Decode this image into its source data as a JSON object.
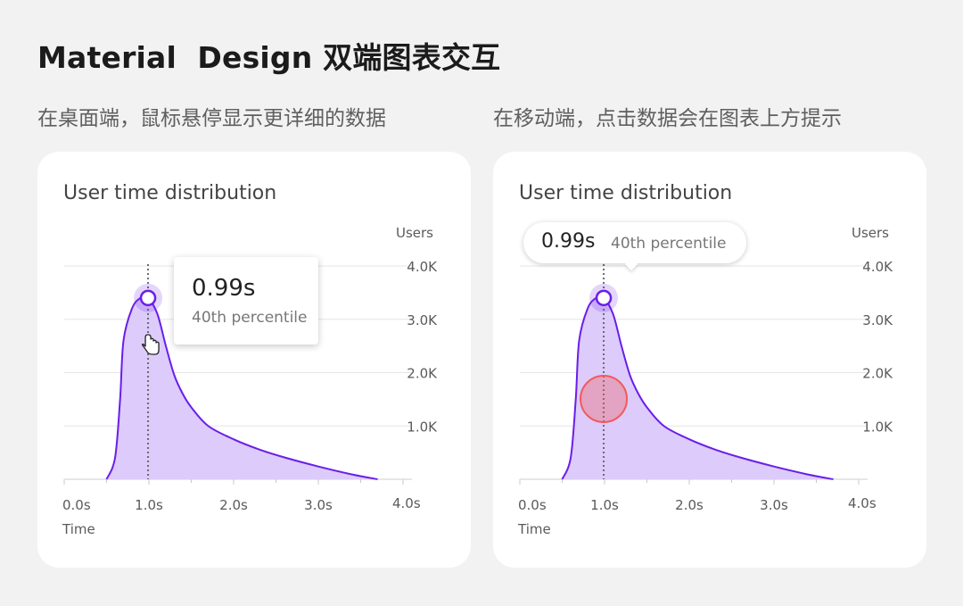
{
  "header": {
    "title": "Material  Design 双端图表交互",
    "caption_left": "在桌面端，鼠标悬停显示更详细的数据",
    "caption_right": "在移动端，点击数据会在图表上方提示"
  },
  "colors": {
    "line": "#6a1ee8",
    "fill": "#dccbfb",
    "touch": "#f25a5a"
  },
  "chart_data": [
    {
      "type": "area",
      "title": "User time distribution",
      "ylabel": "Users",
      "xlabel": "Time",
      "xlim": [
        0,
        4
      ],
      "ylim": [
        0,
        4000
      ],
      "x_ticks": [
        "0.0s",
        "1.0s",
        "2.0s",
        "3.0s",
        "4.0s"
      ],
      "y_ticks": [
        "1.0K",
        "2.0K",
        "3.0K",
        "4.0K"
      ],
      "grid": true,
      "series": [
        {
          "x": [
            0.5,
            0.6,
            0.66,
            0.7,
            0.8,
            0.9,
            0.99,
            1.1,
            1.2,
            1.3,
            1.4,
            1.5,
            1.7,
            2.0,
            2.3,
            2.6,
            3.0,
            3.4,
            3.7
          ],
          "values": [
            0,
            400,
            1500,
            2600,
            3200,
            3400,
            3400,
            3100,
            2500,
            1950,
            1600,
            1350,
            1000,
            750,
            560,
            410,
            240,
            90,
            0
          ]
        }
      ],
      "highlight": {
        "x": 0.99,
        "y": 3400
      },
      "tooltip": {
        "value": "0.99s",
        "label": "40th percentile"
      },
      "interaction": "hover"
    },
    {
      "type": "area",
      "title": "User time distribution",
      "ylabel": "Users",
      "xlabel": "Time",
      "xlim": [
        0,
        4
      ],
      "ylim": [
        0,
        4000
      ],
      "x_ticks": [
        "0.0s",
        "1.0s",
        "2.0s",
        "3.0s",
        "4.0s"
      ],
      "y_ticks": [
        "1.0K",
        "2.0K",
        "3.0K",
        "4.0K"
      ],
      "grid": true,
      "series": [
        {
          "x": [
            0.5,
            0.6,
            0.66,
            0.7,
            0.8,
            0.9,
            0.99,
            1.1,
            1.2,
            1.3,
            1.4,
            1.5,
            1.7,
            2.0,
            2.3,
            2.6,
            3.0,
            3.4,
            3.7
          ],
          "values": [
            0,
            400,
            1500,
            2600,
            3200,
            3400,
            3400,
            3100,
            2500,
            1950,
            1600,
            1350,
            1000,
            750,
            560,
            410,
            240,
            90,
            0
          ]
        }
      ],
      "highlight": {
        "x": 0.99,
        "y": 3400
      },
      "tooltip": {
        "value": "0.99s",
        "label": "40th percentile"
      },
      "interaction": "tap"
    }
  ]
}
